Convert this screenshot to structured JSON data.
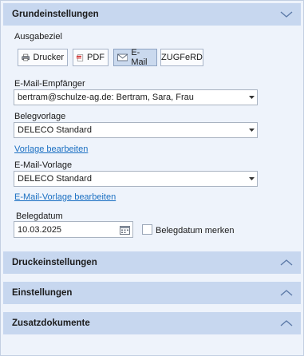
{
  "sections": {
    "grundeinstellungen": "Grundeinstellungen",
    "druckeinstellungen": "Druckeinstellungen",
    "einstellungen": "Einstellungen",
    "zusatzdokumente": "Zusatzdokumente"
  },
  "ausgabeziel": {
    "label": "Ausgabeziel",
    "buttons": {
      "drucker": "Drucker",
      "pdf": "PDF",
      "email": "E-Mail",
      "zugferd": "ZUGFeRD"
    },
    "active": "email"
  },
  "email_empfaenger": {
    "label": "E-Mail-Empfänger",
    "value": "bertram@schulze-ag.de: Bertram, Sara, Frau"
  },
  "belegvorlage": {
    "label": "Belegvorlage",
    "value": "DELECO Standard",
    "link": "Vorlage bearbeiten"
  },
  "email_vorlage": {
    "label": "E-Mail-Vorlage",
    "value": "DELECO Standard",
    "link": "E-Mail-Vorlage bearbeiten"
  },
  "belegdatum": {
    "label": "Belegdatum",
    "value": "10.03.2025",
    "merken_label": "Belegdatum merken",
    "merken_checked": false
  },
  "colors": {
    "header_bg": "#c7d7ef",
    "panel_bg": "#eef3fb",
    "link": "#1a6fc2",
    "chevron": "#5c7aa8"
  },
  "icons": {
    "collapse": "chevron-up-icon",
    "expand": "chevron-down-icon",
    "printer": "printer-icon",
    "pdf": "pdf-icon",
    "email": "envelope-icon",
    "calendar": "calendar-icon",
    "dropdown": "dropdown-arrow-icon"
  }
}
